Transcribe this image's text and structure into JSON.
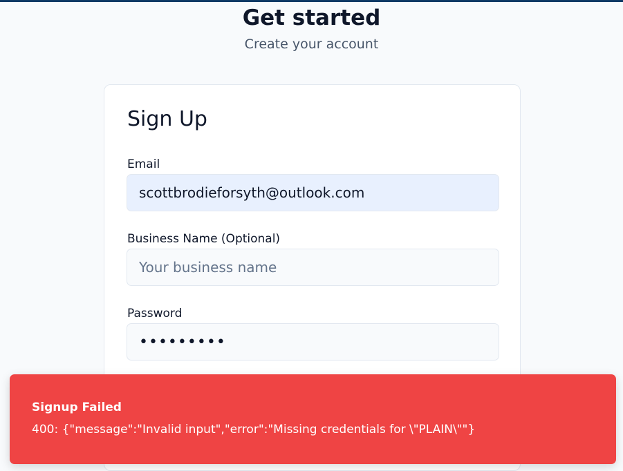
{
  "header": {
    "title": "Get started",
    "subtitle": "Create your account"
  },
  "form": {
    "title": "Sign Up",
    "email": {
      "label": "Email",
      "value": "scottbrodieforsyth@outlook.com"
    },
    "business_name": {
      "label": "Business Name (Optional)",
      "placeholder": "Your business name"
    },
    "password": {
      "label": "Password",
      "value": "•••••••••"
    }
  },
  "toast": {
    "title": "Signup Failed",
    "message": "400: {\"message\":\"Invalid input\",\"error\":\"Missing credentials for \\\"PLAIN\\\"\"}",
    "color": "#ef4444"
  },
  "colors": {
    "accent_bar": "#0f3a66",
    "autofill_bg": "#e8f0fe",
    "page_bg": "#f8fafc"
  }
}
